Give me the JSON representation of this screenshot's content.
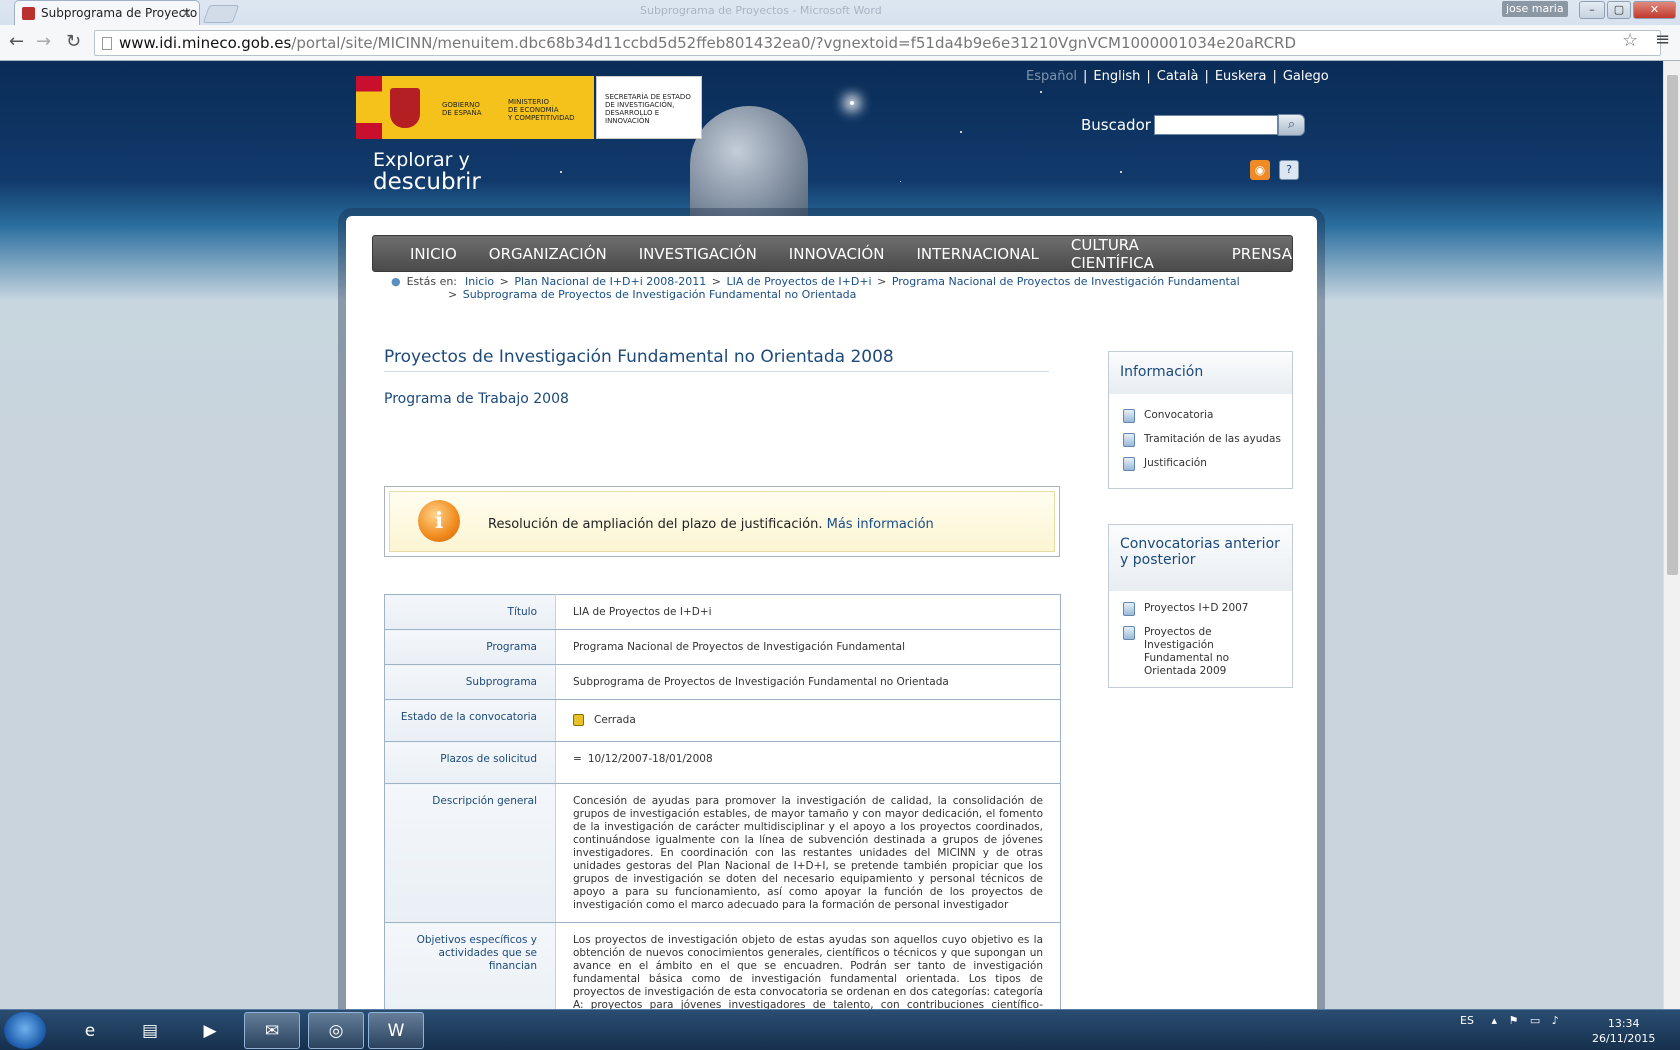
{
  "browser": {
    "tab_title": "Subprograma de Proyecto",
    "tab_close": "×",
    "user": "jose maria",
    "window_blur": "Subprograma de Proyectos - Microsoft Word",
    "url_domain": "www.idi.mineco.gob.es",
    "url_path": "/portal/site/MICINN/menuitem.dbc68b34d11ccbd5d52ffeb801432ea0/?vgnextoid=f51da4b9e6e31210VgnVCM1000001034e20aRCRD",
    "min": "–",
    "max": "▢",
    "close": "✕"
  },
  "header": {
    "logo_gob_lines": [
      "GOBIERNO",
      "DE ESPAÑA"
    ],
    "logo_min_lines": [
      "MINISTERIO",
      "DE ECONOMÍA",
      "Y COMPETITIVIDAD"
    ],
    "logo_sec_lines": [
      "SECRETARÍA DE ESTADO",
      "DE INVESTIGACIÓN,",
      "DESARROLLO E",
      "INNOVACIÓN"
    ],
    "tagline_1": "Explorar y",
    "tagline_2": "descubrir",
    "languages": [
      "Español",
      "English",
      "Català",
      "Euskera",
      "Galego"
    ],
    "search_label": "Buscador",
    "search_placeholder": ""
  },
  "nav": [
    "INICIO",
    "ORGANIZACIÓN",
    "INVESTIGACIÓN",
    "INNOVACIÓN",
    "INTERNACIONAL",
    "CULTURA CIENTÍFICA",
    "PRENSA"
  ],
  "breadcrumb": {
    "label": "Estás en:",
    "items": [
      "Inicio",
      "Plan Nacional de I+D+i 2008-2011",
      "LIA de Proyectos de I+D+i",
      "Programa Nacional de Proyectos de Investigación Fundamental",
      "Subprograma de Proyectos de Investigación Fundamental no Orientada"
    ]
  },
  "main": {
    "title": "Proyectos de Investigación Fundamental no Orientada 2008",
    "subtitle": "Programa de Trabajo 2008",
    "notice_text": "Resolución de ampliación del plazo de justificación.",
    "notice_link": "Más información",
    "rows": [
      {
        "label": "Título",
        "value": "LIA de Proyectos de I+D+i"
      },
      {
        "label": "Programa",
        "value": "Programa Nacional de Proyectos de Investigación Fundamental"
      },
      {
        "label": "Subprograma",
        "value": "Subprograma de Proyectos de Investigación Fundamental no Orientada"
      },
      {
        "label": "Estado de la convocatoria",
        "value": "Cerrada"
      },
      {
        "label": "Plazos de solicitud",
        "value": "10/12/2007-18/01/2008"
      },
      {
        "label": "Descripción general",
        "value": "Concesión de ayudas para promover la investigación de calidad, la consolidación de grupos de investigación estables, de mayor tamaño y con mayor dedicación, el fomento de la investigación de carácter multidisciplinar y el apoyo a los proyectos coordinados, continuándose igualmente con la línea de subvención destinada a grupos de jóvenes investigadores. En coordinación con las restantes unidades del MICINN y de otras unidades gestoras del Plan Nacional de I+D+I, se pretende también propiciar que los grupos de investigación se doten del necesario equipamiento y personal técnicos de apoyo a para su funcionamiento, así como apoyar la función de los proyectos de investigación como el marco adecuado para la formación de personal investigador"
      },
      {
        "label": "Objetivos específicos y actividades que se financian",
        "value": "Los proyectos de investigación objeto de estas ayudas son aquellos cuyo objetivo es la obtención de nuevos conocimientos generales, científicos o técnicos y que supongan un avance en el ámbito en el que se encuadren. Podrán ser tanto de investigación fundamental básica como de investigación fundamental orientada. Los tipos de proyectos de investigación de esta convocatoria se ordenan en dos categorías: categoría A: proyectos para jóvenes investigadores de talento, con contribuciones científico-técnicas relevantes y prometedoras y con líneas de"
      }
    ]
  },
  "sidebar": {
    "info_title": "Información",
    "info_items": [
      "Convocatoria",
      "Tramitación de las ayudas",
      "Justificación"
    ],
    "conv_title": "Convocatorias anterior y posterior",
    "conv_items": [
      "Proyectos I+D 2007",
      "Proyectos de Investigación Fundamental no Orientada 2009"
    ]
  },
  "taskbar": {
    "lang": "ES",
    "time": "13:34",
    "date": "26/11/2015"
  }
}
